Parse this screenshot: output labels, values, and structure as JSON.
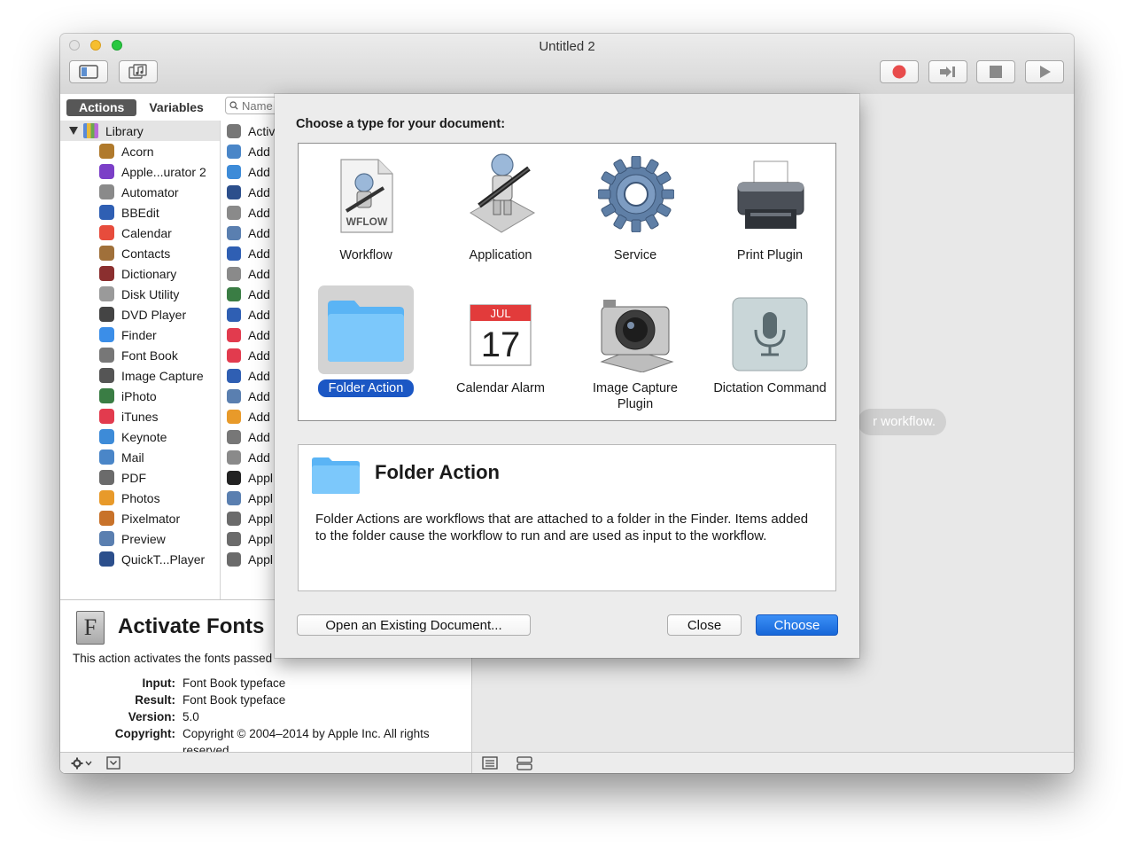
{
  "window": {
    "title": "Untitled 2"
  },
  "library": {
    "tabs": [
      "Actions",
      "Variables"
    ],
    "search_placeholder": "Name",
    "root": "Library",
    "categories": [
      {
        "label": "Acorn",
        "color": "#b07a2c"
      },
      {
        "label": "Apple...urator 2",
        "color": "#7b3fc7"
      },
      {
        "label": "Automator",
        "color": "#8a8a8a"
      },
      {
        "label": "BBEdit",
        "color": "#2f5fb3"
      },
      {
        "label": "Calendar",
        "color": "#e74c3c"
      },
      {
        "label": "Contacts",
        "color": "#a0703a"
      },
      {
        "label": "Dictionary",
        "color": "#8b2f2f"
      },
      {
        "label": "Disk Utility",
        "color": "#9a9a9a"
      },
      {
        "label": "DVD Player",
        "color": "#444444"
      },
      {
        "label": "Finder",
        "color": "#3b8ee8"
      },
      {
        "label": "Font Book",
        "color": "#777777"
      },
      {
        "label": "Image Capture",
        "color": "#555555"
      },
      {
        "label": "iPhoto",
        "color": "#3a7d44"
      },
      {
        "label": "iTunes",
        "color": "#e23b4e"
      },
      {
        "label": "Keynote",
        "color": "#3d8bd8"
      },
      {
        "label": "Mail",
        "color": "#4a86c8"
      },
      {
        "label": "PDF",
        "color": "#6b6b6b"
      },
      {
        "label": "Photos",
        "color": "#e89a2a"
      },
      {
        "label": "Pixelmator",
        "color": "#c8722a"
      },
      {
        "label": "Preview",
        "color": "#5a7fb0"
      },
      {
        "label": "QuickT...Player",
        "color": "#2c4f8c"
      }
    ],
    "actions": [
      {
        "label": "Activ",
        "color": "#777777"
      },
      {
        "label": "Add",
        "color": "#4a86c8"
      },
      {
        "label": "Add",
        "color": "#3d8bd8"
      },
      {
        "label": "Add",
        "color": "#2c4f8c"
      },
      {
        "label": "Add",
        "color": "#8a8a8a"
      },
      {
        "label": "Add",
        "color": "#5a7fb0"
      },
      {
        "label": "Add",
        "color": "#2f5fb3"
      },
      {
        "label": "Add",
        "color": "#8a8a8a"
      },
      {
        "label": "Add",
        "color": "#3a7d44"
      },
      {
        "label": "Add",
        "color": "#2f5fb3"
      },
      {
        "label": "Add",
        "color": "#e23b4e"
      },
      {
        "label": "Add",
        "color": "#e23b4e"
      },
      {
        "label": "Add",
        "color": "#2f5fb3"
      },
      {
        "label": "Add",
        "color": "#5a7fb0"
      },
      {
        "label": "Add",
        "color": "#e89a2a"
      },
      {
        "label": "Add",
        "color": "#777777"
      },
      {
        "label": "Add",
        "color": "#8a8a8a"
      },
      {
        "label": "Appl",
        "color": "#222222"
      },
      {
        "label": "Appl",
        "color": "#5a7fb0"
      },
      {
        "label": "Appl",
        "color": "#6b6b6b"
      },
      {
        "label": "Appl",
        "color": "#6b6b6b"
      },
      {
        "label": "Appl",
        "color": "#6b6b6b"
      }
    ]
  },
  "info": {
    "icon_letter": "F",
    "title": "Activate Fonts",
    "description": "This action activates the fonts passed",
    "rows": [
      {
        "key": "Input:",
        "value": "Font Book typeface"
      },
      {
        "key": "Result:",
        "value": "Font Book typeface"
      },
      {
        "key": "Version:",
        "value": "5.0"
      },
      {
        "key": "Copyright:",
        "value": "Copyright © 2004–2014 by Apple Inc. All rights reserved."
      }
    ]
  },
  "workflow_area": {
    "hint": "r workflow."
  },
  "sheet": {
    "prompt": "Choose a type for your document:",
    "types": [
      {
        "label": "Workflow",
        "icon": "workflow-icon",
        "badge": "WFLOW"
      },
      {
        "label": "Application",
        "icon": "application-icon"
      },
      {
        "label": "Service",
        "icon": "service-gear-icon"
      },
      {
        "label": "Print Plugin",
        "icon": "printer-icon"
      },
      {
        "label": "Folder Action",
        "icon": "folder-icon",
        "selected": true
      },
      {
        "label": "Calendar Alarm",
        "icon": "calendar-icon",
        "cal_month": "JUL",
        "cal_day": "17"
      },
      {
        "label": "Image Capture Plugin",
        "icon": "camera-icon"
      },
      {
        "label": "Dictation Command",
        "icon": "microphone-icon"
      }
    ],
    "selected_title": "Folder Action",
    "selected_description": "Folder Actions are workflows that are attached to a folder in the Finder. Items added to the folder cause the workflow to run and are used as input to the workflow.",
    "buttons": {
      "open": "Open an Existing Document...",
      "close": "Close",
      "choose": "Choose"
    }
  }
}
